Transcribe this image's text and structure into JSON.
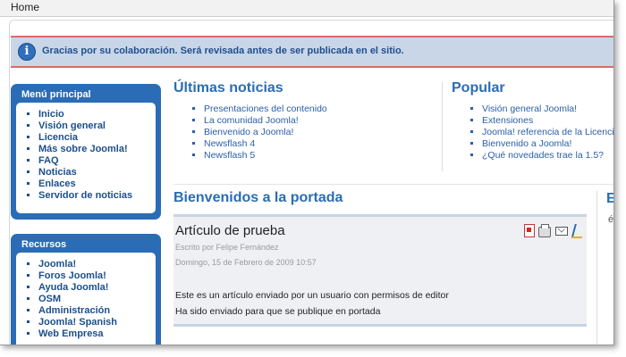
{
  "breadcrumb": {
    "home": "Home"
  },
  "message": {
    "text": "Gracias por su colaboración. Será revisada antes de ser publicada en el sitio."
  },
  "menu_principal": {
    "title": "Menú principal",
    "items": [
      "Inicio",
      "Visión general",
      "Licencia",
      "Más sobre Joomla!",
      "FAQ",
      "Noticias",
      "Enlaces",
      "Servidor de noticias"
    ]
  },
  "recursos": {
    "title": "Recursos",
    "items": [
      "Joomla!",
      "Foros Joomla!",
      "Ayuda Joomla!",
      "OSM",
      "Administración",
      "Joomla! Spanish",
      "Web Empresa"
    ]
  },
  "ultimas": {
    "title": "Últimas noticias",
    "items": [
      "Presentaciones del contenido",
      "La comunidad Joomla!",
      "Bienvenido a Joomla!",
      "Newsflash 4",
      "Newsflash 5"
    ]
  },
  "popular": {
    "title": "Popular",
    "items": [
      "Visión general Joomla!",
      "Extensiones",
      "Joomla! referencia de la Licencia",
      "Bienvenido a Joomla!",
      "¿Qué novedades trae la 1.5?"
    ]
  },
  "frontpage": {
    "title": "Bienvenidos a la portada",
    "right_stub": "E",
    "right_stub2": "é"
  },
  "article": {
    "title": "Artículo de prueba",
    "author": "Escrito por Felipe Fernández",
    "date": "Domingo, 15 de Febrero de 2009 10:57",
    "p1": "Este es un artículo enviado por un usuario con permisos de editor",
    "p2": "Ha sido enviado para que se publique en portada"
  },
  "icons": {
    "info": "info-icon",
    "pdf": "pdf-icon",
    "print": "print-icon",
    "email": "email-icon",
    "edit": "edit-icon"
  }
}
